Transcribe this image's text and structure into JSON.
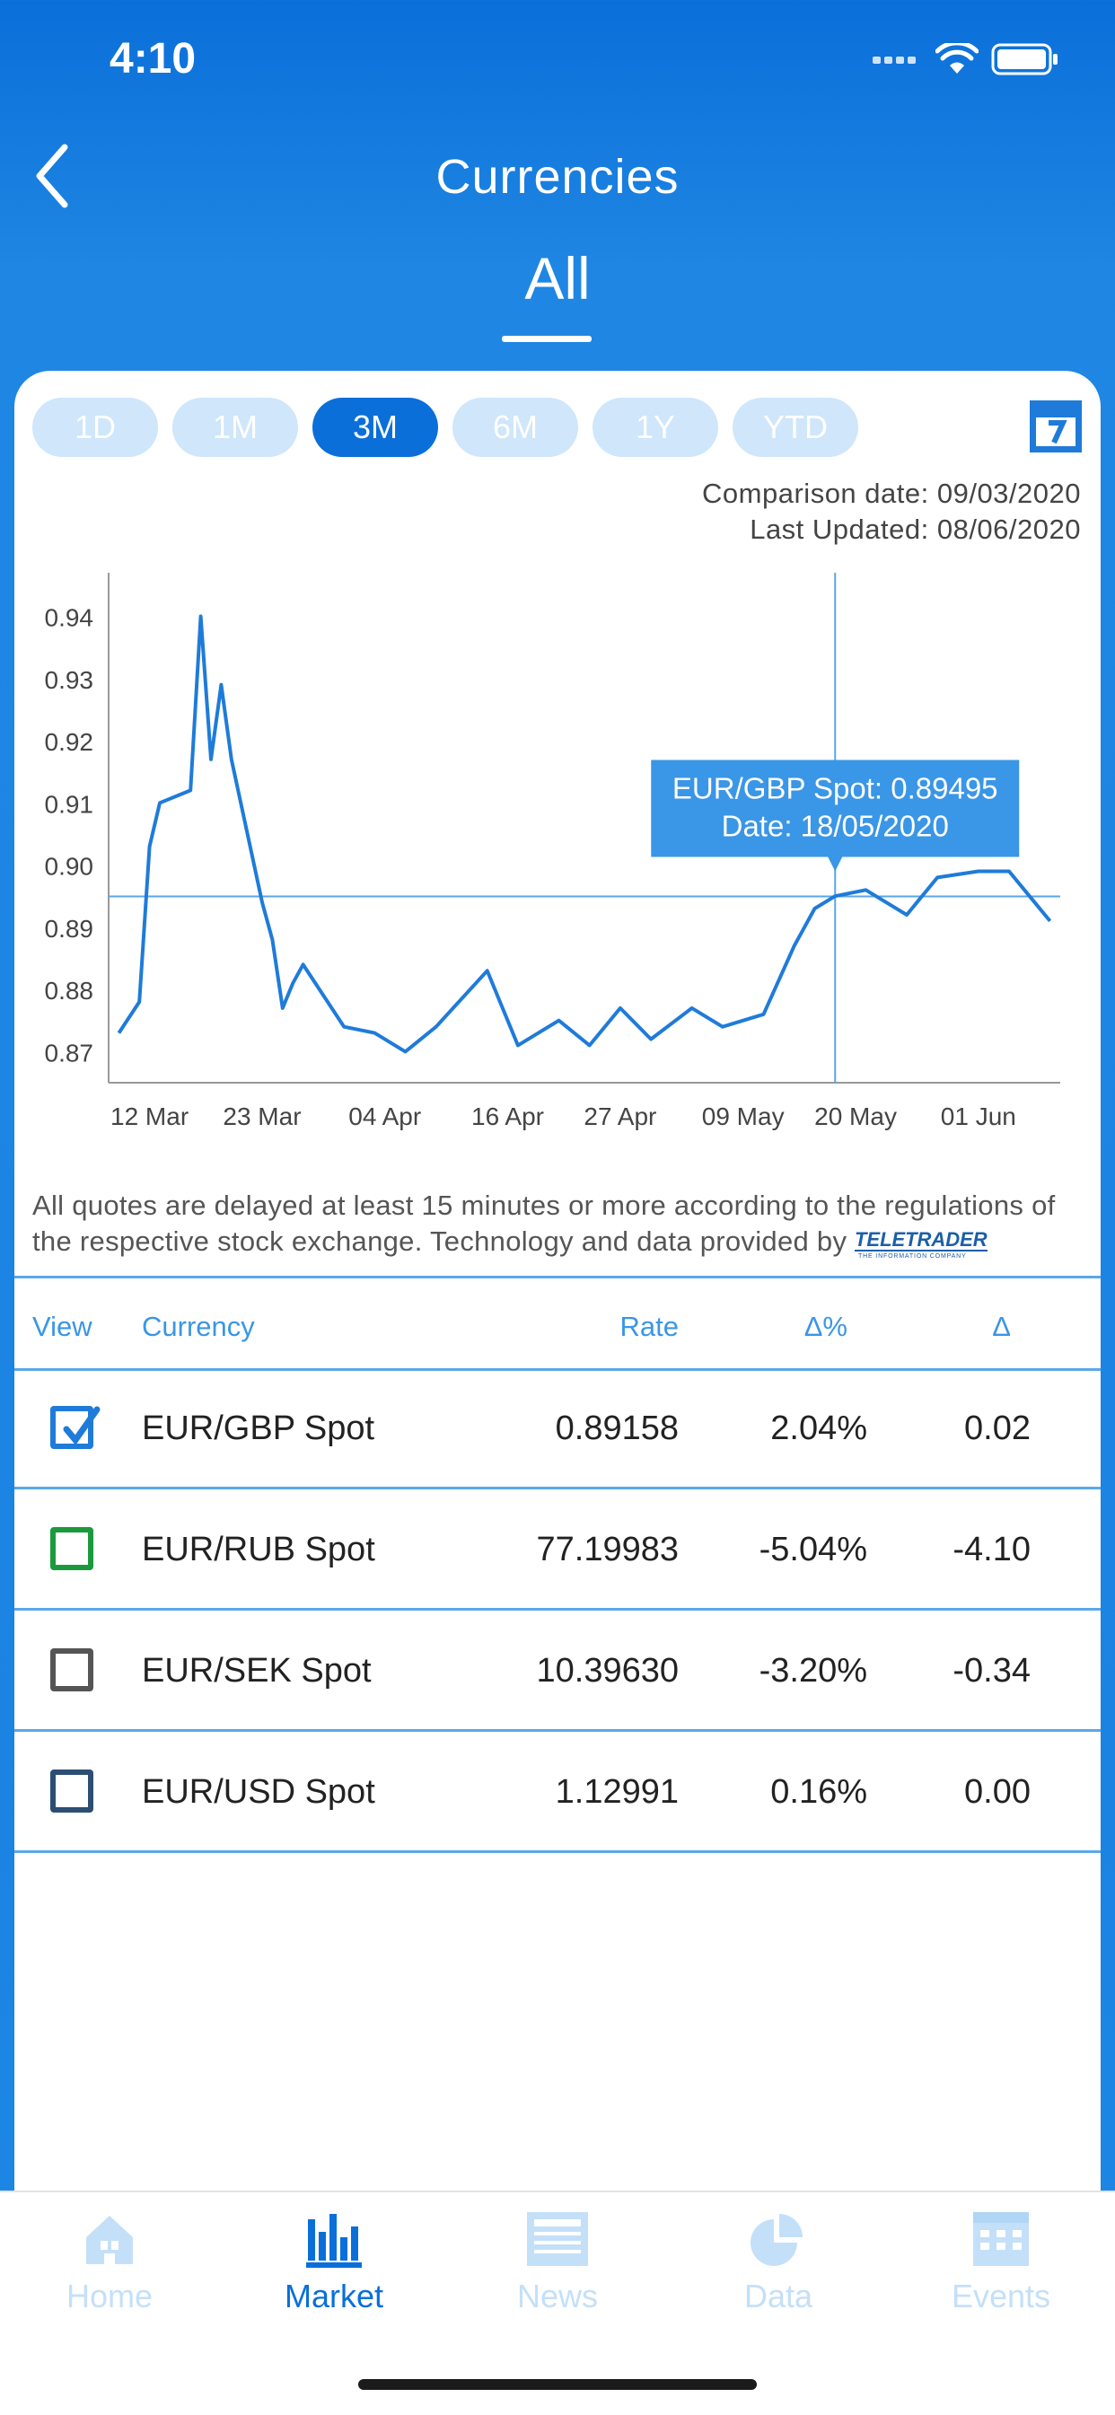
{
  "status": {
    "time": "4:10"
  },
  "header": {
    "title": "Currencies",
    "segment": "All"
  },
  "ranges": [
    "1D",
    "1M",
    "3M",
    "6M",
    "1Y",
    "YTD"
  ],
  "active_range": "3M",
  "meta": {
    "comparison": "Comparison date: 09/03/2020",
    "updated": "Last Updated: 08/06/2020"
  },
  "tooltip": {
    "line1": "EUR/GBP Spot: 0.89495",
    "line2": "Date: 18/05/2020"
  },
  "chart_data": {
    "type": "line",
    "series": [
      {
        "name": "EUR/GBP Spot",
        "color": "#1f7bd9",
        "x": [
          "09/03/2020",
          "11/03/2020",
          "12/03/2020",
          "13/03/2020",
          "16/03/2020",
          "17/03/2020",
          "18/03/2020",
          "19/03/2020",
          "20/03/2020",
          "23/03/2020",
          "24/03/2020",
          "25/03/2020",
          "26/03/2020",
          "27/03/2020",
          "31/03/2020",
          "03/04/2020",
          "06/04/2020",
          "09/04/2020",
          "14/04/2020",
          "17/04/2020",
          "21/04/2020",
          "24/04/2020",
          "27/04/2020",
          "30/04/2020",
          "04/05/2020",
          "07/05/2020",
          "11/05/2020",
          "14/05/2020",
          "16/05/2020",
          "18/05/2020",
          "21/05/2020",
          "25/05/2020",
          "28/05/2020",
          "01/06/2020",
          "04/06/2020",
          "08/06/2020"
        ],
        "values": [
          0.873,
          0.878,
          0.903,
          0.91,
          0.912,
          0.94,
          0.917,
          0.929,
          0.917,
          0.894,
          0.888,
          0.877,
          0.881,
          0.884,
          0.874,
          0.873,
          0.87,
          0.874,
          0.883,
          0.871,
          0.875,
          0.871,
          0.877,
          0.872,
          0.877,
          0.874,
          0.876,
          0.887,
          0.893,
          0.895,
          0.896,
          0.892,
          0.898,
          0.899,
          0.899,
          0.891
        ]
      }
    ],
    "x_ticks": [
      "12 Mar",
      "23 Mar",
      "04 Apr",
      "16 Apr",
      "27 Apr",
      "09 May",
      "20 May",
      "01 Jun"
    ],
    "y_ticks": [
      "0.94",
      "0.93",
      "0.92",
      "0.91",
      "0.90",
      "0.89",
      "0.88",
      "0.87"
    ],
    "ylim": [
      0.865,
      0.947
    ],
    "crosshair": {
      "x": "18/05/2020",
      "y": 0.89495
    },
    "grid": false
  },
  "disclaimer": "All quotes are delayed at least 15 minutes or more according to the regulations of the respective stock exchange. Technology and data provided by",
  "table": {
    "headers": {
      "view": "View",
      "currency": "Currency",
      "rate": "Rate",
      "pct": "Δ%",
      "delta": "Δ"
    },
    "rows": [
      {
        "name": "EUR/GBP Spot",
        "rate": "0.89158",
        "pct": "2.04%",
        "delta": "0.02",
        "checked": true,
        "color": "#1f7bd9"
      },
      {
        "name": "EUR/RUB Spot",
        "rate": "77.19983",
        "pct": "-5.04%",
        "delta": "-4.10",
        "checked": false,
        "color": "#1a9a3c"
      },
      {
        "name": "EUR/SEK Spot",
        "rate": "10.39630",
        "pct": "-3.20%",
        "delta": "-0.34",
        "checked": false,
        "color": "#555555"
      },
      {
        "name": "EUR/USD Spot",
        "rate": "1.12991",
        "pct": "0.16%",
        "delta": "0.00",
        "checked": false,
        "color": "#2d4e73"
      }
    ]
  },
  "tabs": [
    {
      "label": "Home",
      "icon": "home-icon"
    },
    {
      "label": "Market",
      "icon": "bar-chart-icon"
    },
    {
      "label": "News",
      "icon": "newspaper-icon"
    },
    {
      "label": "Data",
      "icon": "pie-chart-icon"
    },
    {
      "label": "Events",
      "icon": "calendar-icon"
    }
  ],
  "active_tab": "Market"
}
